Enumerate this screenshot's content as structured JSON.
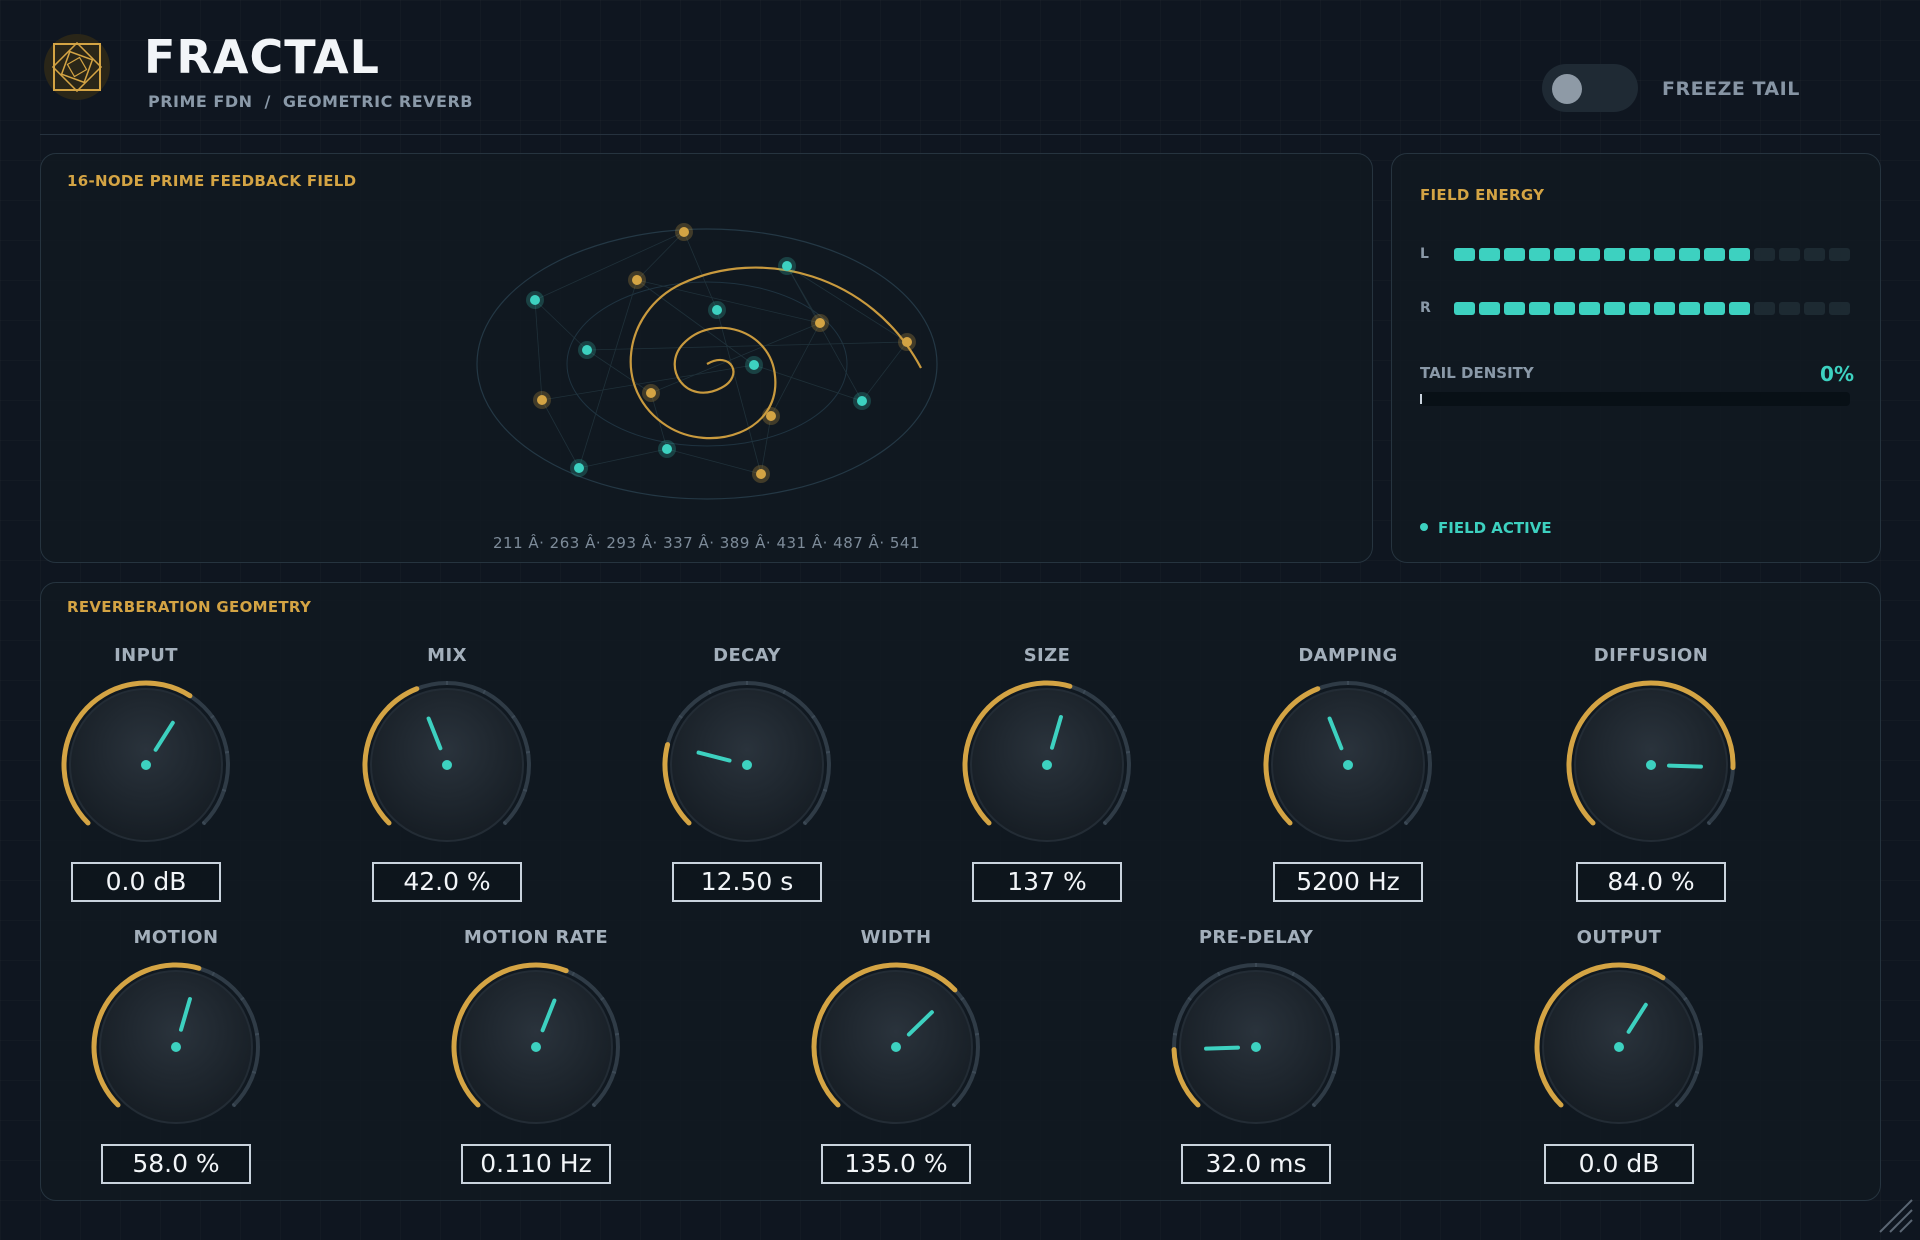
{
  "header": {
    "title": "FRACTAL",
    "subtitle_left": "PRIME FDN",
    "subtitle_sep": "/",
    "subtitle_right": "GEOMETRIC REVERB",
    "freeze_label": "FREEZE TAIL",
    "freeze_on": false
  },
  "field": {
    "title": "16-NODE PRIME FEEDBACK FIELD",
    "primes_text": "211 Â· 263 Â· 293 Â· 337 Â· 389 Â· 431 Â· 487 Â· 541"
  },
  "energy": {
    "title": "FIELD ENERGY",
    "left_label": "L",
    "right_label": "R",
    "left_segments_on": 12,
    "right_segments_on": 12,
    "segments_total": 16,
    "density_label": "TAIL DENSITY",
    "density_value": "0%",
    "status": "FIELD ACTIVE"
  },
  "geometry": {
    "title": "REVERBERATION GEOMETRY",
    "knobs": [
      {
        "label": "INPUT",
        "value": "0.0 dB",
        "level": 0.62
      },
      {
        "label": "MIX",
        "value": "42.0 %",
        "level": 0.42
      },
      {
        "label": "DECAY",
        "value": "12.50 s",
        "level": 0.22
      },
      {
        "label": "SIZE",
        "value": "137 %",
        "level": 0.56
      },
      {
        "label": "DAMPING",
        "value": "5200 Hz",
        "level": 0.42
      },
      {
        "label": "DIFFUSION",
        "value": "84.0 %",
        "level": 0.84
      },
      {
        "label": "MOTION",
        "value": "58.0 %",
        "level": 0.56
      },
      {
        "label": "MOTION RATE",
        "value": "0.110 Hz",
        "level": 0.58
      },
      {
        "label": "WIDTH",
        "value": "135.0 %",
        "level": 0.67
      },
      {
        "label": "PRE-DELAY",
        "value": "32.0 ms",
        "level": 0.16
      },
      {
        "label": "OUTPUT",
        "value": "0.0 dB",
        "level": 0.62
      }
    ]
  },
  "colors": {
    "accent_gold": "#d4a444",
    "accent_teal": "#3dd1c0",
    "background": "#0f1620"
  }
}
